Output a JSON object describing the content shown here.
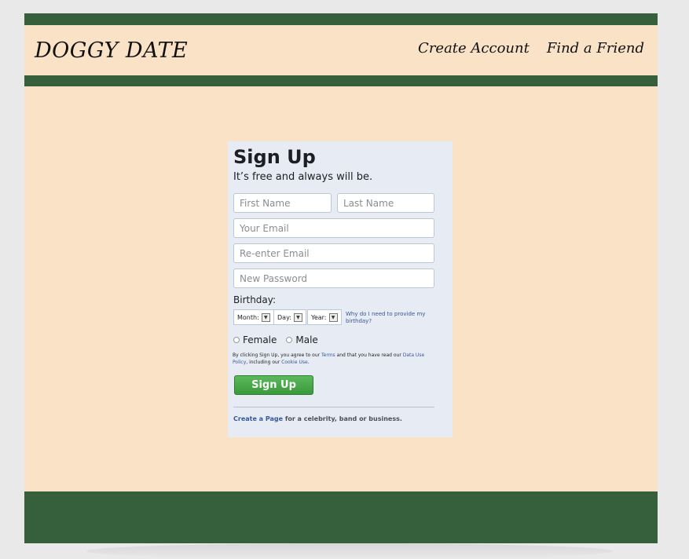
{
  "header": {
    "logo": "DOGGY DATE",
    "nav": [
      "Create Account",
      "Find a Friend"
    ]
  },
  "signup": {
    "title": "Sign Up",
    "subtitle": "It’s free and always will be.",
    "first_name_placeholder": "First Name",
    "last_name_placeholder": "Last Name",
    "email_placeholder": "Your Email",
    "reenter_email_placeholder": "Re-enter Email",
    "password_placeholder": "New Password",
    "birthday_label": "Birthday:",
    "month_label": "Month:",
    "day_label": "Day:",
    "year_label": "Year:",
    "why_link": "Why do I need to provide my birthday?",
    "female_label": "Female",
    "male_label": "Male",
    "terms_1": "By clicking Sign Up, you agree to our ",
    "terms_link": "Terms",
    "terms_2": " and that you have read our ",
    "data_policy_link": "Data Use Policy",
    "terms_3": ", including our ",
    "cookie_link": "Cookie Use",
    "terms_4": ".",
    "button": "Sign Up",
    "create_page_link": "Create a Page",
    "create_page_rest": " for a celebrity, band or business."
  },
  "colors": {
    "band": "#365f3c",
    "background": "#f9e2c6",
    "panel": "#e7ebf3",
    "button": "#4aa94a"
  }
}
